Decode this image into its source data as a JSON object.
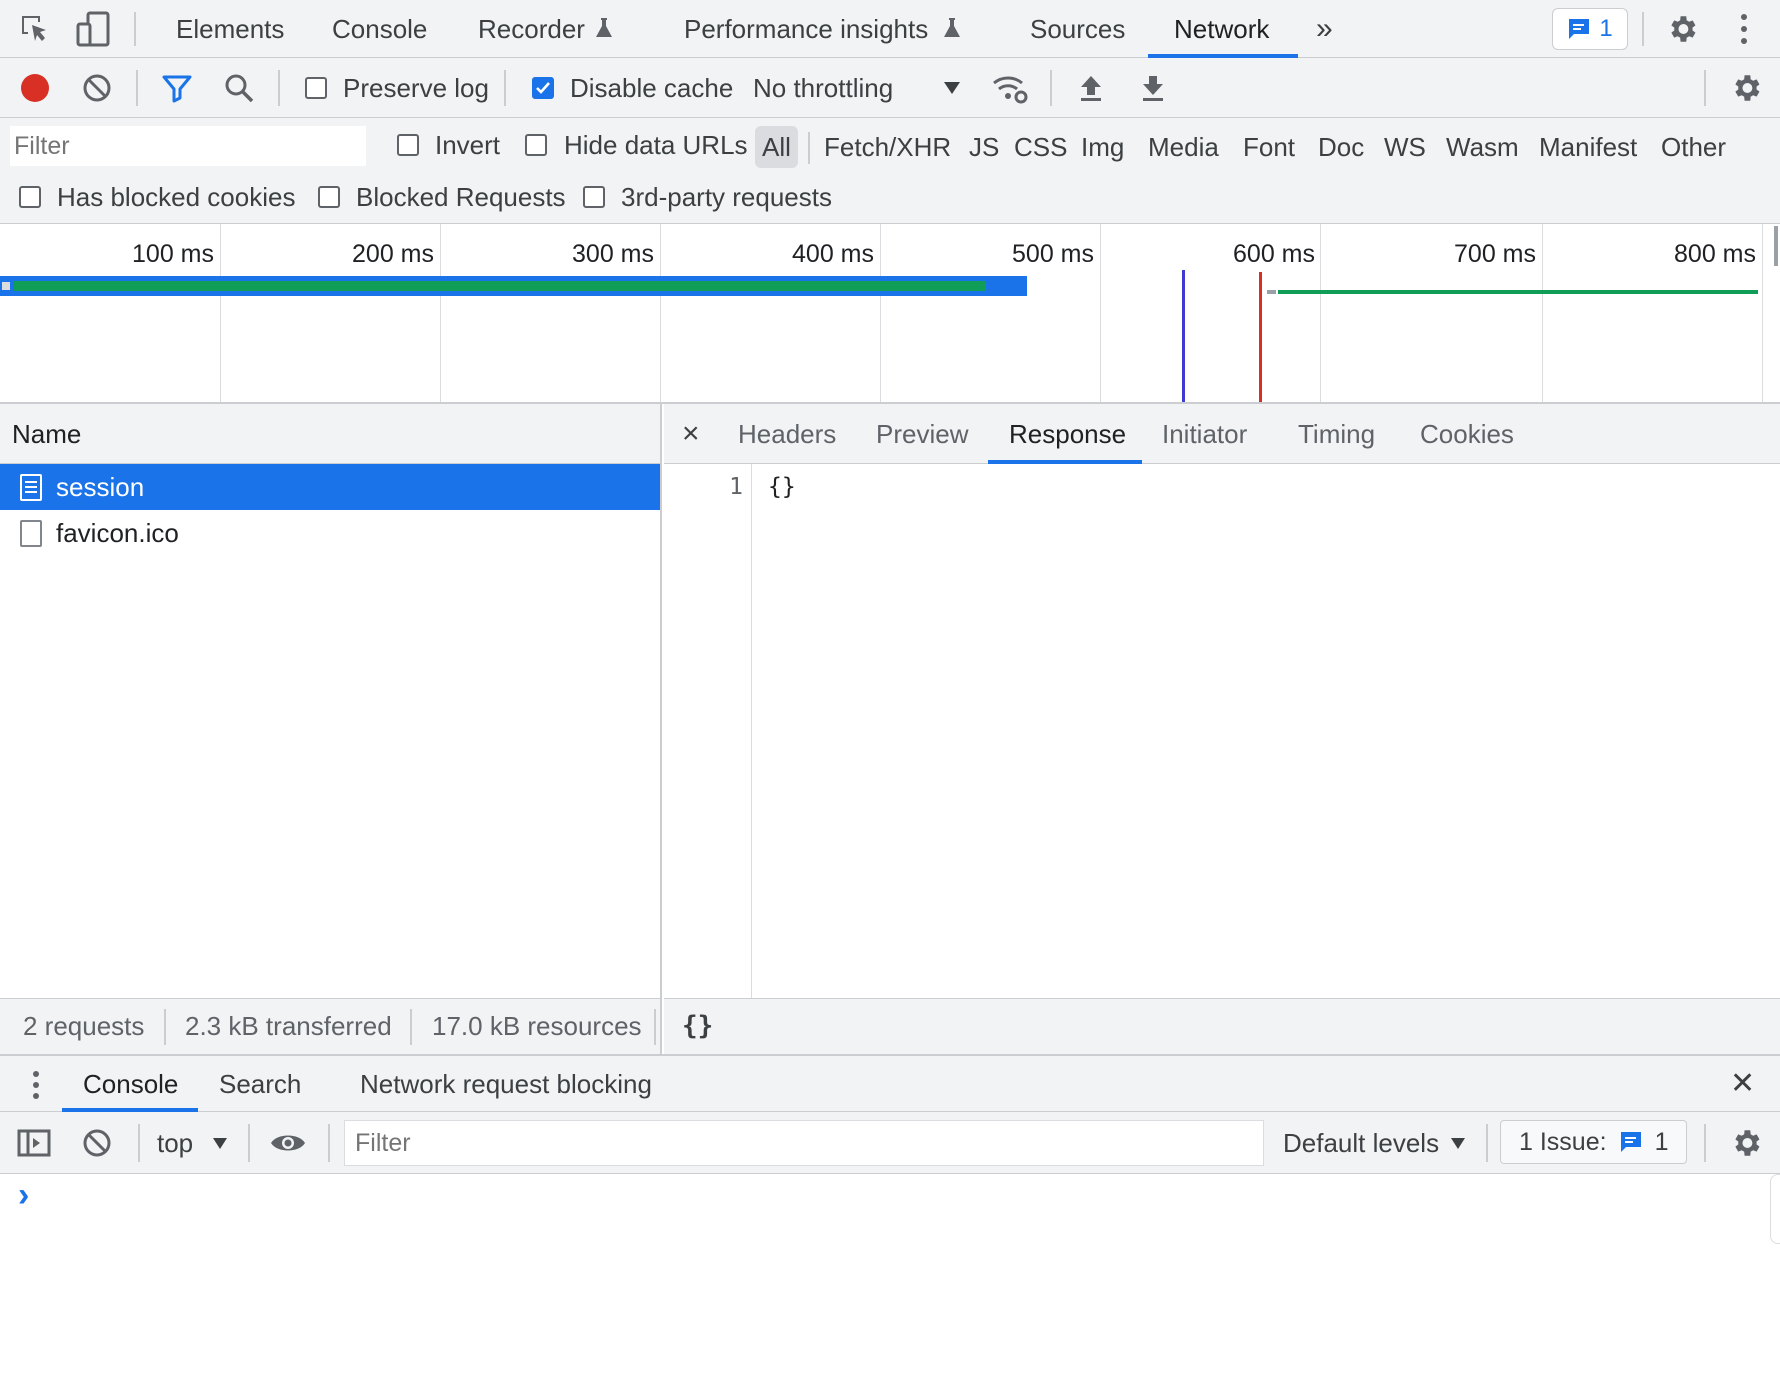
{
  "top_tabs": {
    "elements": "Elements",
    "console": "Console",
    "recorder": "Recorder",
    "performance_insights": "Performance insights",
    "sources": "Sources",
    "network": "Network",
    "more": "»",
    "issues_count": "1"
  },
  "toolbar": {
    "preserve_log": "Preserve log",
    "disable_cache": "Disable cache",
    "throttling": "No throttling"
  },
  "filter": {
    "placeholder": "Filter",
    "invert": "Invert",
    "hide_data_urls": "Hide data URLs",
    "types": [
      "All",
      "Fetch/XHR",
      "JS",
      "CSS",
      "Img",
      "Media",
      "Font",
      "Doc",
      "WS",
      "Wasm",
      "Manifest",
      "Other"
    ],
    "has_blocked_cookies": "Has blocked cookies",
    "blocked_requests": "Blocked Requests",
    "third_party": "3rd-party requests"
  },
  "timeline": {
    "ticks": [
      "100 ms",
      "200 ms",
      "300 ms",
      "400 ms",
      "500 ms",
      "600 ms",
      "700 ms",
      "800 ms"
    ]
  },
  "requests": {
    "header": "Name",
    "rows": [
      {
        "name": "session",
        "selected": true
      },
      {
        "name": "favicon.ico",
        "selected": false
      }
    ],
    "status": {
      "requests": "2 requests",
      "transferred": "2.3 kB transferred",
      "resources": "17.0 kB resources"
    }
  },
  "details": {
    "close": "×",
    "tabs": [
      "Headers",
      "Preview",
      "Response",
      "Initiator",
      "Timing",
      "Cookies"
    ],
    "active_tab": "Response",
    "line_number": "1",
    "response_body": "{}",
    "pretty_print": "{}"
  },
  "drawer": {
    "tabs": [
      "Console",
      "Search",
      "Network request blocking"
    ],
    "close": "✕",
    "context": "top",
    "filter_placeholder": "Filter",
    "levels": "Default levels",
    "issues_label": "1 Issue:",
    "issues_count": "1",
    "prompt": "›"
  },
  "colors": {
    "accent": "#1a73e8",
    "record": "#d93025",
    "waterfall_green": "#0f9d58",
    "dom_content_loaded": "#3c3cd0",
    "load_event": "#d93025"
  }
}
